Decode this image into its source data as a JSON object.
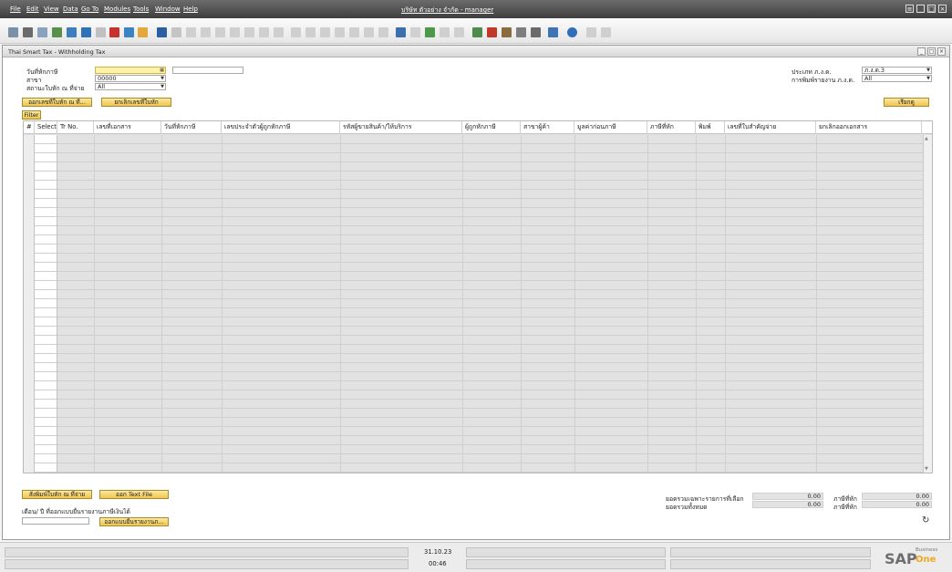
{
  "menubar": {
    "items": [
      "File",
      "Edit",
      "View",
      "Data",
      "Go To",
      "Modules",
      "Tools",
      "Window",
      "Help"
    ],
    "app_title": "บริษัท ตัวอย่าง จำกัด - manager"
  },
  "window": {
    "title": "Thai Smart Tax - Withholding Tax"
  },
  "form": {
    "tax_date_label": "วันที่หักภาษี",
    "tax_date_value": "",
    "branch_label": "สาขา",
    "branch_value": "00000",
    "status_label": "สถานะใบหัก ณ ที่จ่าย",
    "status_value": "All",
    "pnd_type_label": "ประเภท ภ.ง.ด.",
    "pnd_type_value": "ภ.ง.ด.3",
    "report_type_label": "การพิมพ์รายงาน ภ.ง.ด.",
    "report_type_value": "All",
    "issue_cert_button": "ออกเลขที่ใบหัก ณ ที่...",
    "cancel_cert_button": "ยกเลิกเลขที่ใบหัก",
    "fetch_button": "เรียกดู",
    "filter_button": "Filter"
  },
  "grid": {
    "columns": [
      "#",
      "Select",
      "Tr No.",
      "เลขที่เอกสาร",
      "วันที่หักภาษี",
      "เลขประจำตัวผู้ถูกหักภาษี",
      "รหัสผู้ขายสินค้า/ให้บริการ",
      "ผู้ถูกหักภาษี",
      "สาขาผู้ค้า",
      "มูลค่าก่อนภาษี",
      "ภาษีที่หัก",
      "พิมพ์",
      "เลขที่ใบสำคัญจ่าย",
      "ยกเลิกออกเอกสาร"
    ]
  },
  "bottom": {
    "print_cert_button": "สั่งพิมพ์ใบหัก ณ ที่จ่าย",
    "text_file_button": "ออก Text File",
    "month_year_label": "เดือน/ ปี ที่ออกแบบยื่นรายงานภาษีเงินได้",
    "month_year_value": "",
    "submit_report_button": "ออกแบบยื่นรายงานภ...",
    "selected_total_label": "ยอดรวมเฉพาะรายการที่เลือก",
    "selected_total_value": "0.00",
    "selected_tax_label": "ภาษีที่หัก",
    "selected_tax_value": "0.00",
    "grand_total_label": "ยอดรวมทั้งหมด",
    "grand_total_value": "0.00",
    "grand_tax_label": "ภาษีที่หัก",
    "grand_tax_value": "0.00"
  },
  "statusbar": {
    "date": "31.10.23",
    "time": "00:46",
    "logo_main": "SAP",
    "logo_business": "Business",
    "logo_one": "One"
  }
}
